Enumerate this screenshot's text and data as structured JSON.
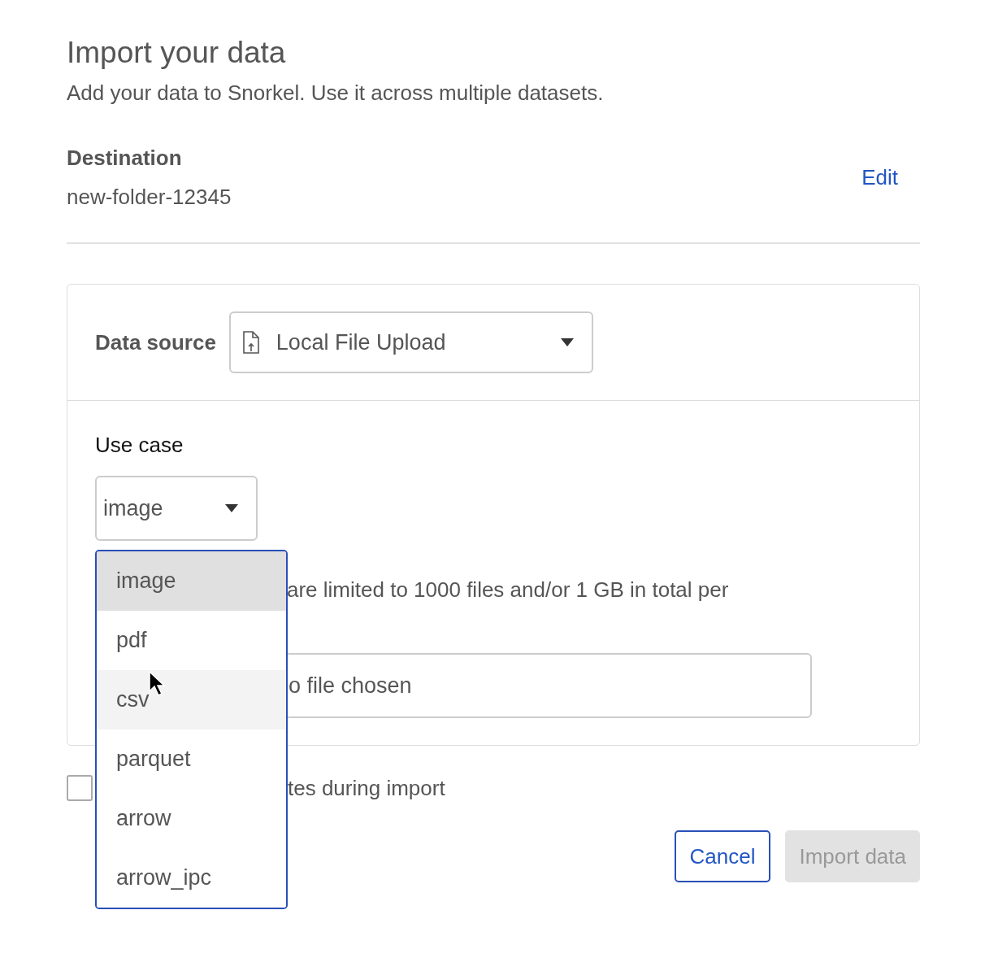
{
  "title": "Import your data",
  "subtitle": "Add your data to Snorkel. Use it across multiple datasets.",
  "destination": {
    "label": "Destination",
    "value": "new-folder-12345",
    "edit": "Edit"
  },
  "data_source": {
    "label": "Data source",
    "value": "Local File Upload"
  },
  "use_case": {
    "label": "Use case",
    "value": "image"
  },
  "note": "are limited to 1000 files and/or 1 GB in total per",
  "file_field": {
    "value": "o file chosen"
  },
  "option": {
    "label": "tes during import",
    "checked": false
  },
  "menu": [
    {
      "label": "image",
      "selected": true,
      "hovered": false
    },
    {
      "label": "pdf",
      "selected": false,
      "hovered": false
    },
    {
      "label": "csv",
      "selected": false,
      "hovered": true
    },
    {
      "label": "parquet",
      "selected": false,
      "hovered": false
    },
    {
      "label": "arrow",
      "selected": false,
      "hovered": false
    },
    {
      "label": "arrow_ipc",
      "selected": false,
      "hovered": false
    }
  ],
  "buttons": [
    {
      "label": "Cancel",
      "disabled": false
    },
    {
      "label": "Import data",
      "disabled": true
    }
  ]
}
